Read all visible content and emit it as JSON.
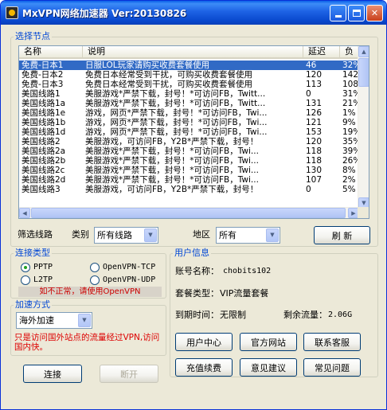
{
  "window": {
    "title": "MxVPN网络加速器 Ver:20130826"
  },
  "nodes": {
    "group_label": "选择节点",
    "columns": [
      "名称",
      "说明",
      "延迟",
      "负"
    ],
    "rows": [
      {
        "name": "免费-日本1",
        "desc": "日服LOL玩家请购买收费套餐使用",
        "latency": "46",
        "load": "32%",
        "selected": true
      },
      {
        "name": "免费-日本2",
        "desc": "免费日本经常受到干扰，可购买收费套餐使用",
        "latency": "120",
        "load": "142"
      },
      {
        "name": "免费-日本3",
        "desc": "免费日本经常受到干扰，可购买收费套餐使用",
        "latency": "113",
        "load": "108"
      },
      {
        "name": "美国线路1",
        "desc": "美服游戏*严禁下载，封号！*可访问FB，Twitt...",
        "latency": "0",
        "load": "31%"
      },
      {
        "name": "美国线路1a",
        "desc": "美服游戏*严禁下载，封号！*可访问FB，Twitt...",
        "latency": "131",
        "load": "21%"
      },
      {
        "name": "美国线路1e",
        "desc": "游戏，网页*严禁下载，封号！*可访问FB，Twi...",
        "latency": "126",
        "load": "1%"
      },
      {
        "name": "美国线路1b",
        "desc": "游戏，网页*严禁下载，封号！*可访问FB，Twi...",
        "latency": "121",
        "load": "9%"
      },
      {
        "name": "美国线路1d",
        "desc": "游戏，网页*严禁下载，封号！*可访问FB，Twi...",
        "latency": "153",
        "load": "19%"
      },
      {
        "name": "美国线路2",
        "desc": "美服游戏，可访问FB，Y2B*严禁下载，封号！",
        "latency": "120",
        "load": "35%"
      },
      {
        "name": "美国线路2a",
        "desc": "美服游戏*严禁下载，封号！*可访问FB，Twi...",
        "latency": "118",
        "load": "39%"
      },
      {
        "name": "美国线路2b",
        "desc": "美服游戏*严禁下载，封号！*可访问FB，Twi...",
        "latency": "118",
        "load": "26%"
      },
      {
        "name": "美国线路2c",
        "desc": "美服游戏*严禁下载，封号！*可访问FB，Twi...",
        "latency": "130",
        "load": "8%"
      },
      {
        "name": "美国线路2d",
        "desc": "美服游戏*严禁下载，封号！*可访问FB，Twi...",
        "latency": "107",
        "load": "2%"
      },
      {
        "name": "美国线路3",
        "desc": "美服游戏，可访问FB，Y2B*严禁下载，封号！",
        "latency": "0",
        "load": "5%"
      }
    ]
  },
  "filter": {
    "label": "筛选线路",
    "category_label": "类别",
    "category_value": "所有线路",
    "region_label": "地区",
    "region_value": "所有",
    "refresh_label": "刷 新"
  },
  "connection": {
    "group_label": "连接类型",
    "options": [
      "PPTP",
      "OpenVPN-TCP",
      "L2TP",
      "OpenVPN-UDP"
    ],
    "warning": "如不正常，请使用OpenVPN"
  },
  "acceleration": {
    "group_label": "加速方式",
    "mode_value": "海外加速",
    "note": "只是访问国外站点的流量经过VPN,访问国内快。"
  },
  "user": {
    "group_label": "用户信息",
    "account_label": "账号名称：",
    "account_value": "chobits102",
    "plan_label": "套餐类型：",
    "plan_value": "VIP流量套餐",
    "expiry_label": "到期时间：",
    "expiry_value": "无限制",
    "traffic_label": "剩余流量：",
    "traffic_value": "2.06G"
  },
  "buttons": {
    "user_center": "用户中心",
    "official_site": "官方网站",
    "contact_support": "联系客服",
    "recharge": "充值续费",
    "feedback": "意见建议",
    "faq": "常见问题",
    "connect": "连接",
    "disconnect": "断开"
  }
}
